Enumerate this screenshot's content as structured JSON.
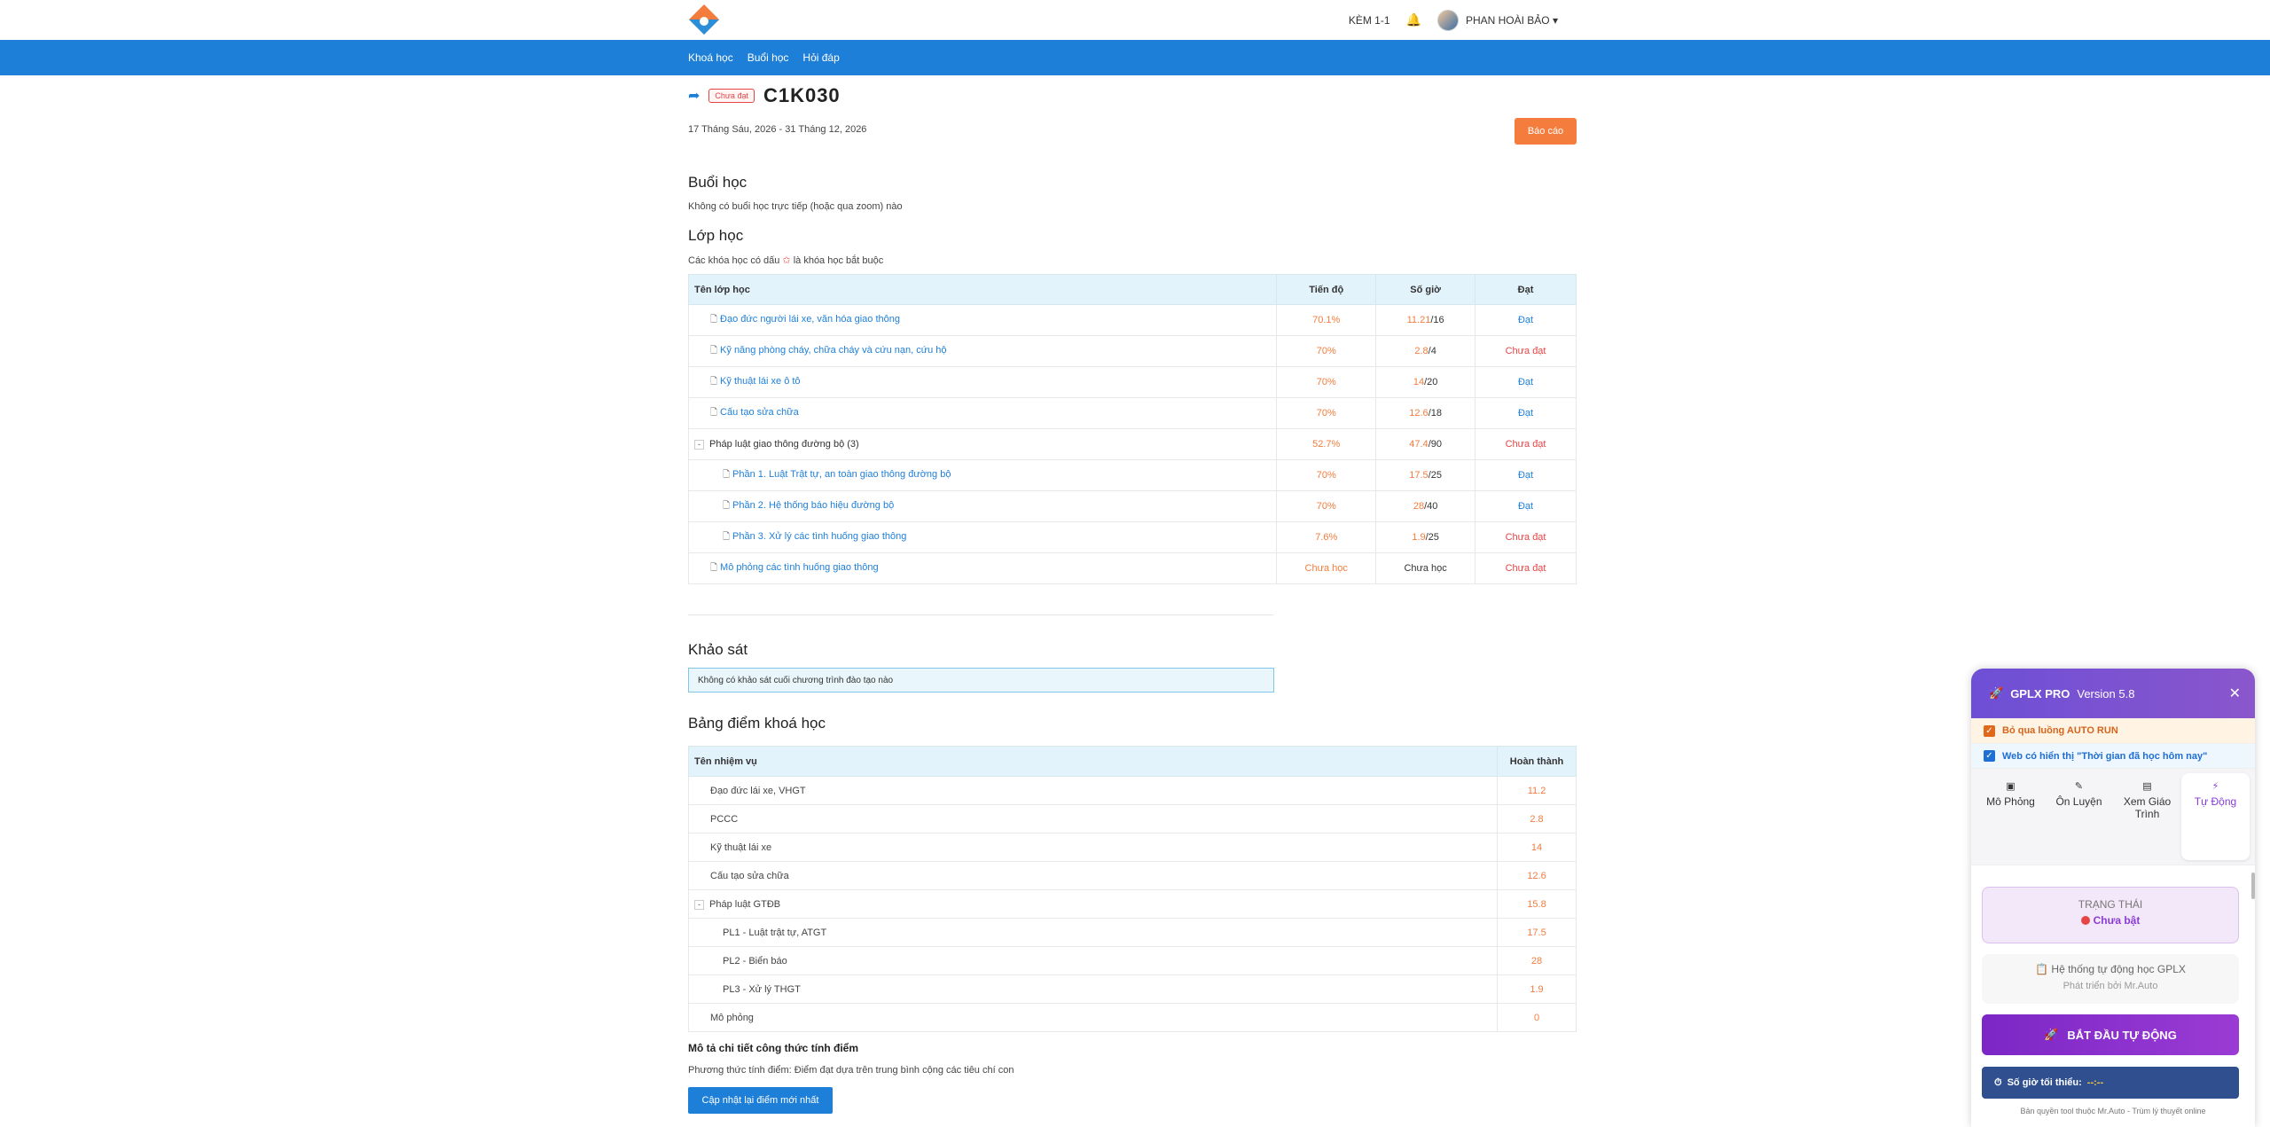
{
  "header": {
    "user_level": "KÈM 1-1",
    "user_name": "PHAN HOÀI BẢO ▾"
  },
  "nav": [
    "Khoá học",
    "Buổi học",
    "Hỏi đáp"
  ],
  "course": {
    "status": "Chưa đạt",
    "code": "C1K030",
    "dates": "17 Tháng Sáu, 2026 - 31 Tháng 12, 2026",
    "report_label": "Báo cáo"
  },
  "sessions": {
    "title": "Buổi học",
    "note": "Không có buổi học trực tiếp (hoặc qua zoom) nào"
  },
  "classes": {
    "title": "Lớp học",
    "note_prefix": "Các khóa học có dấu",
    "note_star": "✩",
    "note_suffix": "là khóa học bắt buộc",
    "headers": [
      "Tên lớp học",
      "Tiến độ",
      "Số giờ",
      "Đạt"
    ],
    "rows": [
      {
        "name": "Đạo đức người lái xe, văn hóa giao thông",
        "progress": "70.1%",
        "hours_done": "11.21",
        "hours_total": "/16",
        "result": "Đạt"
      },
      {
        "name": "Kỹ năng phòng cháy, chữa cháy và cứu nạn, cứu hộ",
        "progress": "70%",
        "hours_done": "2.8",
        "hours_total": "/4",
        "result": "Chưa đạt"
      },
      {
        "name": "Kỹ thuật lái xe ô tô",
        "progress": "70%",
        "hours_done": "14",
        "hours_total": "/20",
        "result": "Đạt"
      },
      {
        "name": "Cấu tạo sửa chữa",
        "progress": "70%",
        "hours_done": "12.6",
        "hours_total": "/18",
        "result": "Đạt"
      },
      {
        "name": "Pháp luật giao thông đường bộ",
        "count": "(3)",
        "progress": "52.7%",
        "hours_done": "47.4",
        "hours_total": "/90",
        "result": "Chưa đạt"
      },
      {
        "name": "Phần 1. Luật Trật tự, an toàn giao thông đường bộ",
        "progress": "70%",
        "hours_done": "17.5",
        "hours_total": "/25",
        "result": "Đạt"
      },
      {
        "name": "Phần 2. Hệ thống báo hiệu đường bộ",
        "progress": "70%",
        "hours_done": "28",
        "hours_total": "/40",
        "result": "Đạt"
      },
      {
        "name": "Phần 3. Xử lý các tình huống giao thông",
        "progress": "7.6%",
        "hours_done": "1.9",
        "hours_total": "/25",
        "result": "Chưa đạt"
      },
      {
        "name": "Mô phỏng các tình huống giao thông",
        "progress": "Chưa học",
        "hours_text": "Chưa học",
        "result": "Chưa đạt"
      }
    ]
  },
  "survey": {
    "title": "Khảo sát",
    "note": "Không có khảo sát cuối chương trình đào tạo nào"
  },
  "scores": {
    "title": "Bảng điểm khoá học",
    "headers": [
      "Tên nhiệm vụ",
      "Hoàn thành"
    ],
    "rows": [
      {
        "name": "Đạo đức lái xe, VHGT",
        "value": "11.2"
      },
      {
        "name": "PCCC",
        "value": "2.8"
      },
      {
        "name": "Kỹ thuật lái xe",
        "value": "14"
      },
      {
        "name": "Cấu tạo sửa chữa",
        "value": "12.6"
      },
      {
        "name": "Pháp luật GTĐB",
        "value": "15.8"
      },
      {
        "name": "PL1 - Luật trật tự, ATGT",
        "value": "17.5"
      },
      {
        "name": "PL2 - Biển báo",
        "value": "28"
      },
      {
        "name": "PL3 - Xử lý THGT",
        "value": "1.9"
      },
      {
        "name": "Mô phỏng",
        "value": "0"
      }
    ],
    "formula_title": "Mô tả chi tiết công thức tính điểm",
    "formula_desc": "Phương thức tính điểm: Điểm đạt dựa trên trung bình cộng các tiêu chí con",
    "update_label": "Cập nhật lại điểm mới nhất"
  },
  "panel": {
    "name": "GPLX PRO",
    "version": "Version 5.8",
    "close": "✕",
    "skip_autorun": "Bỏ qua luồng AUTO RUN",
    "show_time": "Web có hiển thị \"Thời gian đã học hôm nay\"",
    "tabs": [
      {
        "icon": "▣",
        "label": "Mô Phỏng"
      },
      {
        "icon": "✎",
        "label": "Ôn Luyện"
      },
      {
        "icon": "▤",
        "label": "Xem Giáo Trình"
      },
      {
        "icon": "⚡",
        "label": "Tự Động"
      }
    ],
    "status_label": "TRẠNG THÁI",
    "status_value": "Chưa bật",
    "system_label": "Hệ thống tự động học GPLX",
    "developer": "Phát triển bởi Mr.Auto",
    "start_label": "BẮT ĐẦU TỰ ĐỘNG",
    "min_hours_label": "Số giờ tối thiểu:",
    "min_hours_value": "--:--",
    "copyright": "Bản quyền tool thuộc Mr.Auto - Trùm lý thuyết online",
    "accent": "#8a3bd8"
  }
}
